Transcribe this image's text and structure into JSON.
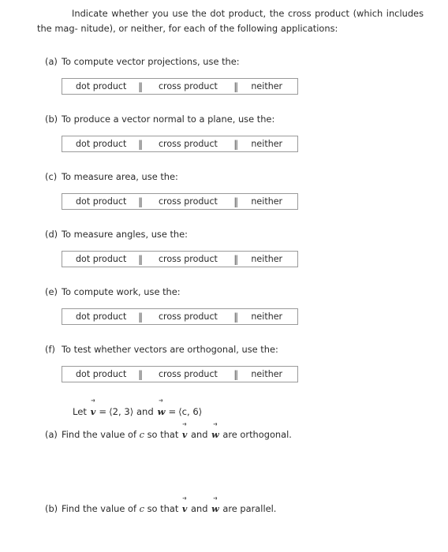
{
  "document": {
    "intro": {
      "line1": "Indicate whether you use the dot product, the cross product (which includes the mag-",
      "line2": "nitude), or neither, for each of the following applications:"
    },
    "options": {
      "dot": "dot product",
      "cross": "cross product",
      "neither": "neither",
      "separator": "‖"
    },
    "questions": [
      {
        "label": "(a)",
        "prompt": "To compute vector projections, use the:"
      },
      {
        "label": "(b)",
        "prompt": "To produce a vector normal to a plane, use the:"
      },
      {
        "label": "(c)",
        "prompt": "To measure area, use the:"
      },
      {
        "label": "(d)",
        "prompt": "To measure angles, use the:"
      },
      {
        "label": "(e)",
        "prompt": "To compute work, use the:"
      },
      {
        "label": "(f)",
        "prompt": "To test whether vectors are orthogonal, use the:"
      }
    ],
    "given": {
      "lead": "Let",
      "vector_v": "v",
      "eq1": "=",
      "components_v": "⟨2, 3⟩",
      "conjunction": "and",
      "vector_w": "w",
      "eq2": "=",
      "components_w": "⟨c, 6⟩"
    },
    "final_questions": [
      {
        "label": "(a)",
        "text_before": "Find the value of",
        "variable": "c",
        "text_mid": "so that",
        "vector_1": "v",
        "conjunction": "and",
        "vector_2": "w",
        "text_after": "are orthogonal."
      },
      {
        "label": "(b)",
        "text_before": "Find the value of",
        "variable": "c",
        "text_mid": "so that",
        "vector_1": "v",
        "conjunction": "and",
        "vector_2": "w",
        "text_after": "are parallel."
      }
    ]
  },
  "colors": {
    "text": "#2b2b2b",
    "box_border": "#9a9a9a",
    "background": "#ffffff"
  }
}
